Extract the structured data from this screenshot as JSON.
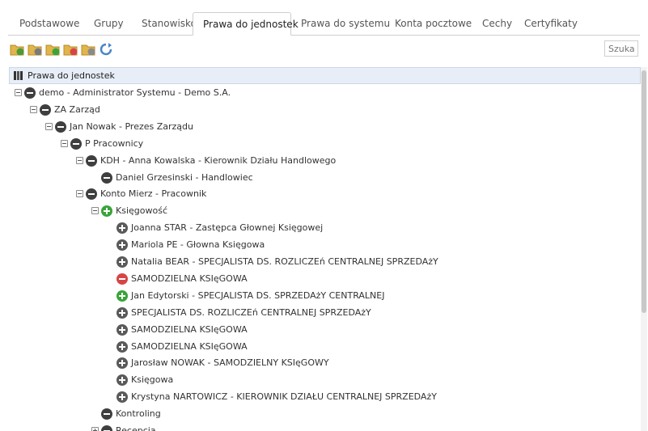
{
  "tabs": [
    {
      "label": "Podstawowe"
    },
    {
      "label": "Grupy"
    },
    {
      "label": "Stanowisko"
    },
    {
      "label": "Prawa do jednostek",
      "active": true
    },
    {
      "label": "Prawa do systemu"
    },
    {
      "label": "Konta pocztowe"
    },
    {
      "label": "Cechy"
    },
    {
      "label": "Certyfikaty"
    }
  ],
  "toolbar": {
    "buttons": [
      {
        "icon": "folder-add-icon"
      },
      {
        "icon": "folder-edit-icon"
      },
      {
        "icon": "folder-grant-icon"
      },
      {
        "icon": "folder-deny-icon"
      },
      {
        "icon": "folder-neutral-icon"
      },
      {
        "icon": "refresh-icon"
      }
    ],
    "search_placeholder": "Szukaj"
  },
  "colors": {
    "accent_bg": "#e8eef7",
    "grant": "#3aa43a",
    "deny": "#d64545",
    "neutral": "#5a5a5a"
  },
  "tree": {
    "root_label": "Prawa do jednostek",
    "nodes": [
      {
        "label": "demo - Administrator Systemu - Demo S.A.",
        "level": 0,
        "exp": "minus",
        "state": "dark"
      },
      {
        "label": "ZA Zarząd",
        "level": 1,
        "exp": "minus",
        "state": "dark"
      },
      {
        "label": "Jan Nowak - Prezes Zarządu",
        "level": 2,
        "exp": "minus",
        "state": "dark"
      },
      {
        "label": "P Pracownicy",
        "level": 3,
        "exp": "minus",
        "state": "dark"
      },
      {
        "label": "KDH - Anna Kowalska - Kierownik Działu Handlowego",
        "level": 4,
        "exp": "minus",
        "state": "dark"
      },
      {
        "label": "Daniel Grzesinski - Handlowiec",
        "level": 5,
        "exp": "",
        "state": "dark"
      },
      {
        "label": "Konto Mierz - Pracownik",
        "level": 4,
        "exp": "minus",
        "state": "dark"
      },
      {
        "label": "Księgowość",
        "level": 5,
        "exp": "minus",
        "state": "green"
      },
      {
        "label": "Joanna STAR - Zastępca Głownej Księgowej",
        "level": 6,
        "exp": "",
        "state": "gray"
      },
      {
        "label": "Mariola PE - Głowna Księgowa",
        "level": 6,
        "exp": "",
        "state": "gray"
      },
      {
        "label": "Natalia BEAR - SPECJALISTA DS. ROZLICZEń CENTRALNEJ SPRZEDAżY",
        "level": 6,
        "exp": "",
        "state": "gray"
      },
      {
        "label": "SAMODZIELNA KSIęGOWA",
        "level": 6,
        "exp": "",
        "state": "red"
      },
      {
        "label": "Jan Edytorski - SPECJALISTA DS. SPRZEDAżY CENTRALNEJ",
        "level": 6,
        "exp": "",
        "state": "green"
      },
      {
        "label": "SPECJALISTA DS. ROZLICZEń CENTRALNEJ SPRZEDAżY",
        "level": 6,
        "exp": "",
        "state": "gray"
      },
      {
        "label": "SAMODZIELNA KSIęGOWA",
        "level": 6,
        "exp": "",
        "state": "gray"
      },
      {
        "label": "SAMODZIELNA KSIęGOWA",
        "level": 6,
        "exp": "",
        "state": "gray"
      },
      {
        "label": "Jarosław NOWAK - SAMODZIELNY KSIęGOWY",
        "level": 6,
        "exp": "",
        "state": "gray"
      },
      {
        "label": "Księgowa",
        "level": 6,
        "exp": "",
        "state": "gray"
      },
      {
        "label": "Krystyna NARTOWICZ - KIEROWNIK DZIAŁU CENTRALNEJ SPRZEDAżY",
        "level": 6,
        "exp": "",
        "state": "gray"
      },
      {
        "label": "Kontroling",
        "level": 5,
        "exp": "",
        "state": "dark"
      },
      {
        "label": "Recepcja",
        "level": 5,
        "exp": "plus",
        "state": "dark"
      }
    ]
  }
}
